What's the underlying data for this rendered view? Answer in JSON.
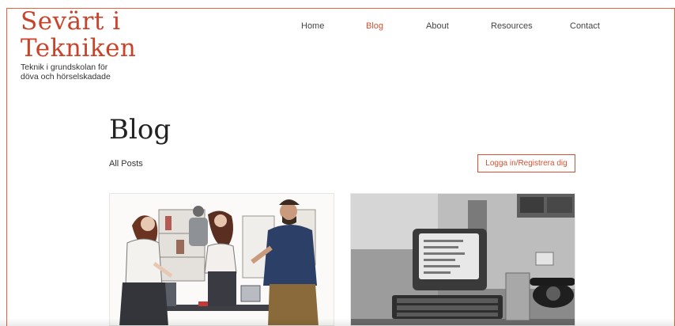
{
  "site": {
    "title_line1": "Sevärt i",
    "title_line2": "Tekniken",
    "subtitle": "Teknik i grundskolan för döva och hörselskadade"
  },
  "nav": {
    "items": [
      {
        "label": "Home",
        "active": false
      },
      {
        "label": "Blog",
        "active": true
      },
      {
        "label": "About",
        "active": false
      },
      {
        "label": "Resources",
        "active": false
      },
      {
        "label": "Contact",
        "active": false
      }
    ]
  },
  "main": {
    "title": "Blog",
    "filter_label": "All Posts",
    "login_label": "Logga in/Registrera dig"
  },
  "colors": {
    "accent": "#d4522f",
    "logo": "#c8432a",
    "frame": "#e8603c"
  },
  "posts": [
    {
      "image": "illustration-classroom-people"
    },
    {
      "image": "photo-vintage-computer-telephone"
    }
  ]
}
